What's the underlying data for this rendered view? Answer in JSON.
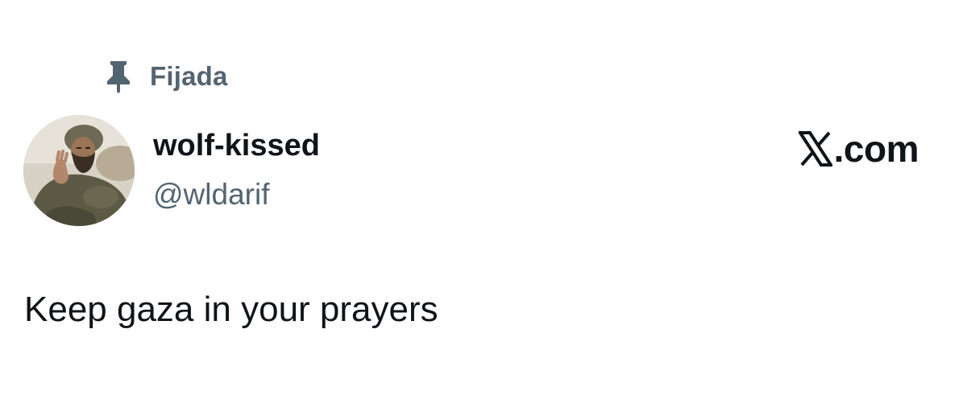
{
  "pinned": {
    "icon": "pin-icon",
    "label": "Fijada"
  },
  "author": {
    "display_name": "wolf-kissed",
    "handle": "@wldarif",
    "avatar_icon": "avatar-photo"
  },
  "brand": {
    "logo_icon": "x-logo-icon",
    "text": ".com"
  },
  "tweet": {
    "text": "Keep gaza in your prayers"
  },
  "colors": {
    "text_primary": "#0f1419",
    "text_secondary": "#536471",
    "background": "#ffffff"
  }
}
